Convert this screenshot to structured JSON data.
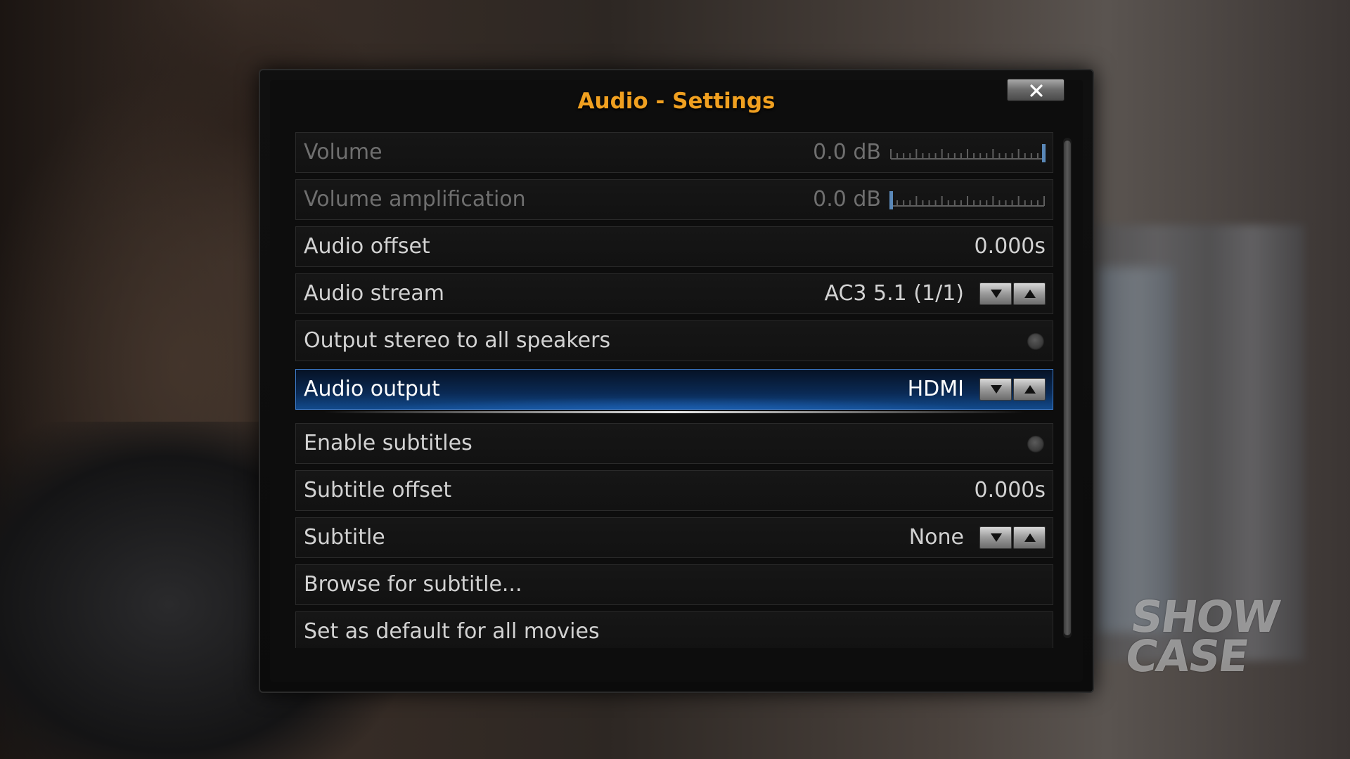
{
  "dialog": {
    "title": "Audio - Settings",
    "close_icon": "close-x-icon"
  },
  "background": {
    "watermark": [
      "SHOW",
      "CASE"
    ]
  },
  "settings": {
    "volume": {
      "label": "Volume",
      "value": "0.0 dB",
      "slider_level": 1.0,
      "enabled": false
    },
    "volume_amplification": {
      "label": "Volume amplification",
      "value": "0.0 dB",
      "slider_level": 0.0,
      "enabled": false
    },
    "audio_offset": {
      "label": "Audio offset",
      "value": "0.000s"
    },
    "audio_stream": {
      "label": "Audio stream",
      "value": "AC3 5.1 (1/1)"
    },
    "output_stereo": {
      "label": "Output stereo to all speakers",
      "checked": false
    },
    "audio_output": {
      "label": "Audio output",
      "value": "HDMI",
      "focused": true
    },
    "enable_subtitles": {
      "label": "Enable subtitles",
      "checked": false
    },
    "subtitle_offset": {
      "label": "Subtitle offset",
      "value": "0.000s"
    },
    "subtitle": {
      "label": "Subtitle",
      "value": "None"
    },
    "browse_subtitle": {
      "label": "Browse for subtitle..."
    },
    "set_default": {
      "label": "Set as default for all movies"
    }
  },
  "colors": {
    "title": "#f0a020",
    "focus": "#124a8c",
    "text": "#d2d2d2",
    "disabled_text": "#6f6f6f"
  }
}
